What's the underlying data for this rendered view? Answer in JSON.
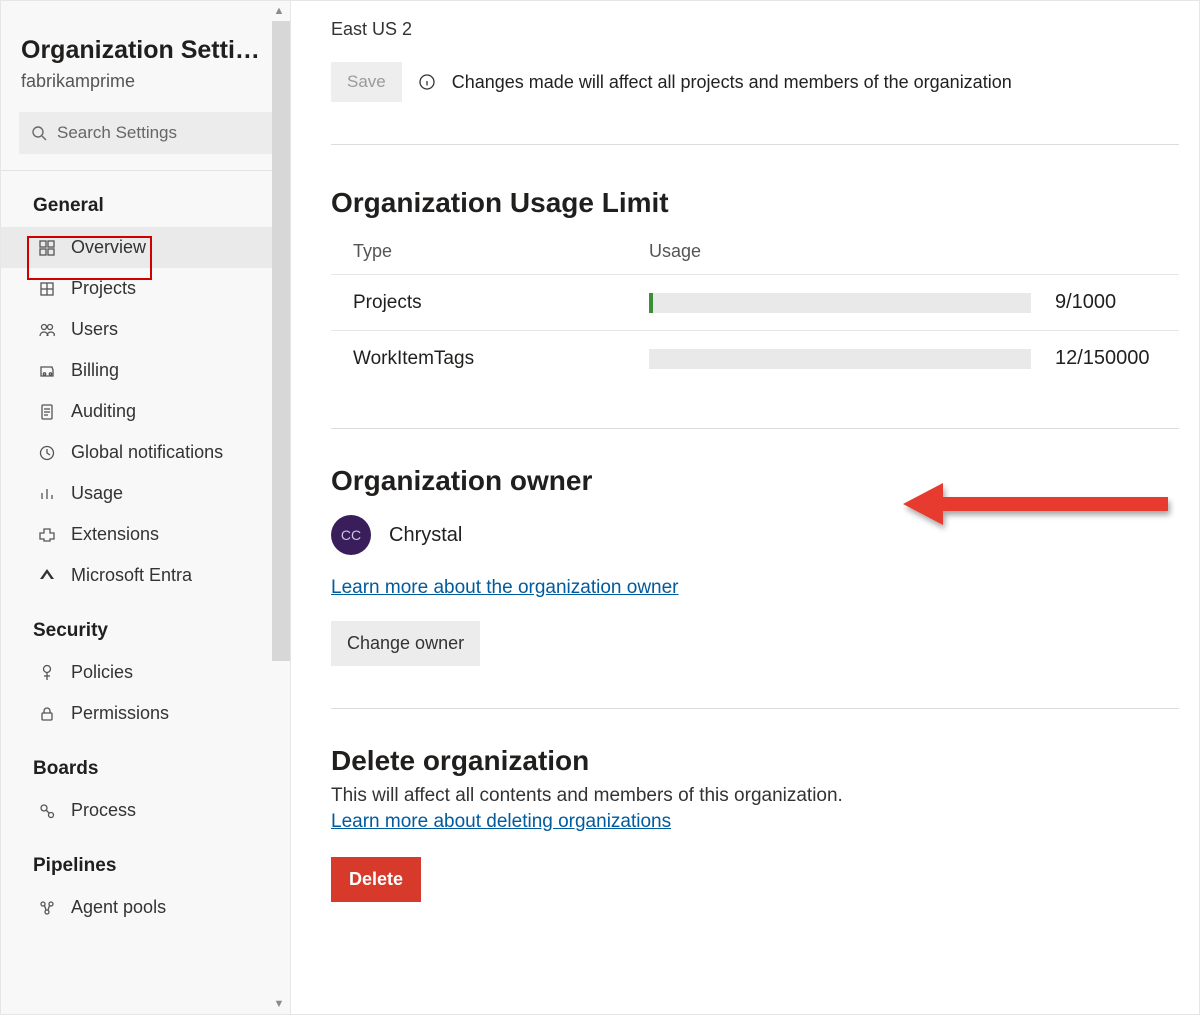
{
  "sidebar": {
    "title": "Organization Settin...",
    "subtitle": "fabrikamprime",
    "search_placeholder": "Search Settings",
    "groups": [
      {
        "title": "General",
        "items": [
          {
            "id": "overview",
            "label": "Overview",
            "active": true
          },
          {
            "id": "projects",
            "label": "Projects"
          },
          {
            "id": "users",
            "label": "Users"
          },
          {
            "id": "billing",
            "label": "Billing"
          },
          {
            "id": "auditing",
            "label": "Auditing"
          },
          {
            "id": "global-notifications",
            "label": "Global notifications"
          },
          {
            "id": "usage",
            "label": "Usage"
          },
          {
            "id": "extensions",
            "label": "Extensions"
          },
          {
            "id": "microsoft-entra",
            "label": "Microsoft Entra"
          }
        ]
      },
      {
        "title": "Security",
        "items": [
          {
            "id": "policies",
            "label": "Policies"
          },
          {
            "id": "permissions",
            "label": "Permissions"
          }
        ]
      },
      {
        "title": "Boards",
        "items": [
          {
            "id": "process",
            "label": "Process"
          }
        ]
      },
      {
        "title": "Pipelines",
        "items": [
          {
            "id": "agent-pools",
            "label": "Agent pools"
          }
        ]
      }
    ]
  },
  "main": {
    "region": "East US 2",
    "save_label": "Save",
    "save_info": "Changes made will affect all projects and members of the organization",
    "usage": {
      "heading": "Organization Usage Limit",
      "col_type": "Type",
      "col_usage": "Usage",
      "rows": [
        {
          "type": "Projects",
          "used": 9,
          "limit": 1000,
          "display": "9/1000"
        },
        {
          "type": "WorkItemTags",
          "used": 12,
          "limit": 150000,
          "display": "12/150000"
        }
      ]
    },
    "owner": {
      "heading": "Organization owner",
      "initials": "CC",
      "name": "Chrystal",
      "learn_link": "Learn more about the organization owner",
      "change_label": "Change owner"
    },
    "delete": {
      "heading": "Delete organization",
      "desc": "This will affect all contents and members of this organization.",
      "learn_link": "Learn more about deleting organizations",
      "button": "Delete"
    }
  }
}
